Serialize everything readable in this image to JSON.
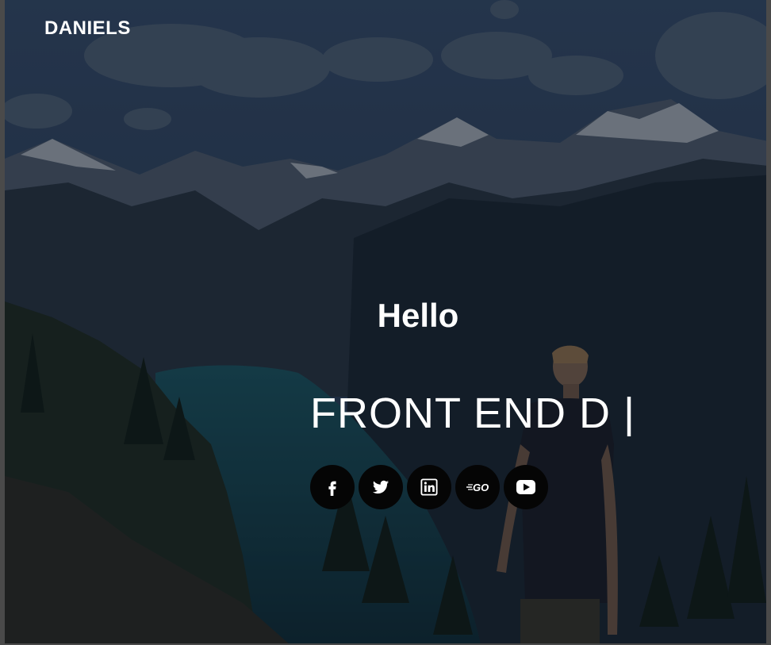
{
  "brand": {
    "name": "DANIELS"
  },
  "hero": {
    "greeting": "Hello",
    "role_typed": "FRONT END D",
    "cursor": "|"
  },
  "socials": [
    {
      "name": "facebook-icon"
    },
    {
      "name": "twitter-icon"
    },
    {
      "name": "linkedin-icon"
    },
    {
      "name": "goodreads-icon",
      "glyph": "GO"
    },
    {
      "name": "youtube-icon"
    }
  ],
  "colors": {
    "text": "#ffffff",
    "social_bg": "#050505",
    "overlay": "#0b1320"
  }
}
